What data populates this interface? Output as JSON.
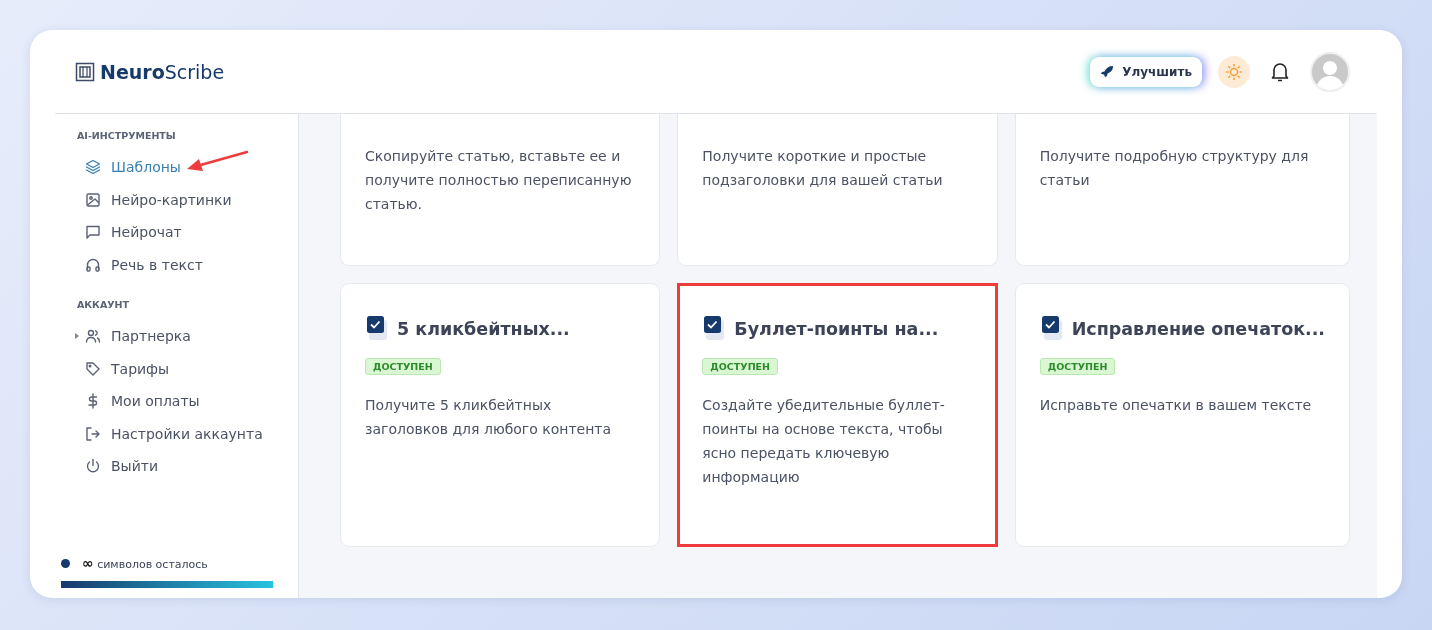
{
  "brand": {
    "bold": "Neuro",
    "light": "Scribe"
  },
  "header": {
    "upgrade": "Улучшить"
  },
  "sidebar": {
    "sections": [
      {
        "title": "AI-ИНСТРУМЕНТЫ",
        "items": [
          {
            "label": "Шаблоны",
            "selected": true,
            "annotated": true,
            "expandable": false
          },
          {
            "label": "Нейро-картинки",
            "selected": false,
            "annotated": false,
            "expandable": false
          },
          {
            "label": "Нейрочат",
            "selected": false,
            "annotated": false,
            "expandable": false
          },
          {
            "label": "Речь в текст",
            "selected": false,
            "annotated": false,
            "expandable": false
          }
        ]
      },
      {
        "title": "АККАУНТ",
        "items": [
          {
            "label": "Партнерка",
            "selected": false,
            "annotated": false,
            "expandable": true
          },
          {
            "label": "Тарифы",
            "selected": false,
            "annotated": false,
            "expandable": false
          },
          {
            "label": "Мои оплаты",
            "selected": false,
            "annotated": false,
            "expandable": false
          },
          {
            "label": "Настройки аккаунта",
            "selected": false,
            "annotated": false,
            "expandable": false
          },
          {
            "label": "Выйти",
            "selected": false,
            "annotated": false,
            "expandable": false
          }
        ]
      }
    ],
    "quota": {
      "amount": "∞",
      "label": "символов осталось",
      "level": 1
    }
  },
  "cards": [
    {
      "description": "Скопируйте статью, вставьте ее и получите полностью переписанную статью.",
      "highlighted": false
    },
    {
      "description": "Получите короткие и простые подзаголовки для вашей статьи",
      "highlighted": false
    },
    {
      "description": "Получите подробную структуру для статьи",
      "highlighted": false
    },
    {
      "title": "5 кликбейтных...",
      "badge": "ДОСТУПЕН",
      "description": "Получите 5 кликбейтных заголовков для любого контента",
      "highlighted": false
    },
    {
      "title": "Буллет-поинты на...",
      "badge": "ДОСТУПЕН",
      "description": "Создайте убедительные буллет-поинты на основе текста, чтобы ясно передать ключевую информацию",
      "highlighted": true
    },
    {
      "title": "Исправление опечаток...",
      "badge": "ДОСТУПЕН",
      "description": "Исправьте опечатки в вашем тексте",
      "highlighted": false
    }
  ]
}
